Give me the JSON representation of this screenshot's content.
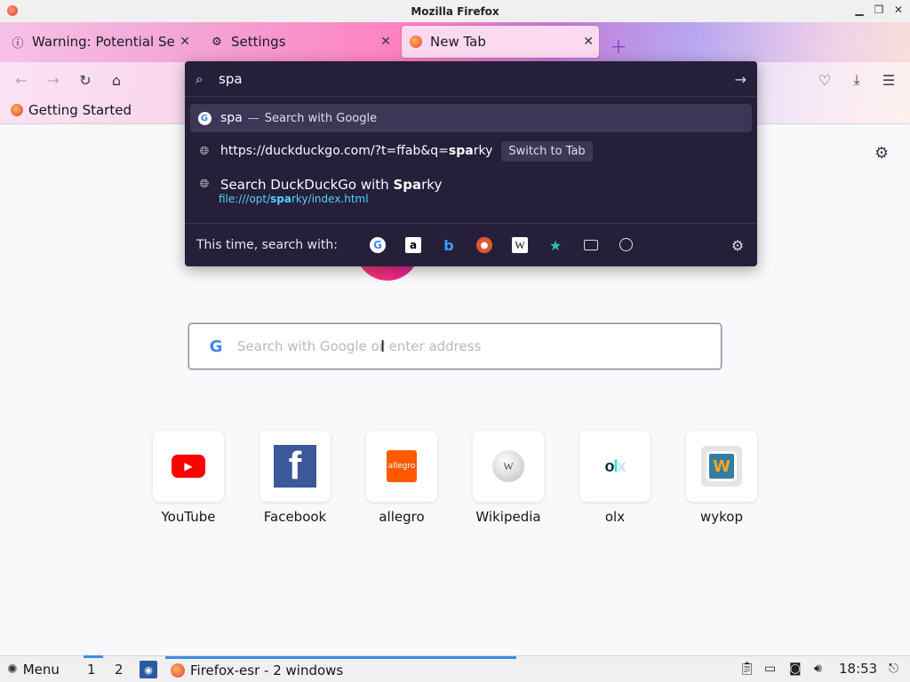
{
  "window": {
    "title": "Mozilla Firefox",
    "controls": [
      "minimize",
      "maximize",
      "close"
    ]
  },
  "tabs": [
    {
      "label": "Warning: Potential Se",
      "icon": "warning-info-icon",
      "active": false
    },
    {
      "label": "Settings",
      "icon": "gear-icon",
      "active": false
    },
    {
      "label": "New Tab",
      "icon": "firefox-icon",
      "active": true
    }
  ],
  "navbar": {
    "buttons": [
      "back",
      "forward",
      "reload",
      "home",
      "pocket",
      "downloads",
      "menu"
    ]
  },
  "bookmarks": [
    {
      "label": "Getting Started",
      "icon": "firefox-icon"
    }
  ],
  "urlbar": {
    "value": "spa",
    "suggestions": [
      {
        "type": "search",
        "icon": "google-icon",
        "text": "spa",
        "action": "Search with Google"
      },
      {
        "type": "tab",
        "icon": "globe-icon",
        "prefix": "https://duckduckgo.com/?t=ffab&q=",
        "match": "spa",
        "suffix": "rky",
        "action": "Switch to Tab"
      },
      {
        "type": "history",
        "icon": "globe-icon",
        "prefix": "Search DuckDuckGo with ",
        "match": "Spa",
        "suffix": "rky",
        "url_prefix": "file:///opt/",
        "url_match": "spa",
        "url_suffix": "rky/index.html"
      }
    ],
    "search_with_label": "This time, search with:",
    "engines": [
      "google",
      "amazon",
      "bing",
      "duckduckgo",
      "wikipedia",
      "bookmarks",
      "tabs",
      "history"
    ]
  },
  "page": {
    "search_placeholder": "Search with Google or enter address",
    "top_sites": [
      {
        "name": "YouTube",
        "icon": "youtube-icon"
      },
      {
        "name": "Facebook",
        "icon": "facebook-icon"
      },
      {
        "name": "allegro",
        "icon": "allegro-icon"
      },
      {
        "name": "Wikipedia",
        "icon": "wikipedia-icon"
      },
      {
        "name": "olx",
        "icon": "olx-icon"
      },
      {
        "name": "wykop",
        "icon": "wykop-icon"
      }
    ]
  },
  "taskbar": {
    "menu_label": "Menu",
    "workspaces": [
      "1",
      "2"
    ],
    "task_label": "Firefox-esr - 2 windows",
    "clock": "18:53"
  }
}
